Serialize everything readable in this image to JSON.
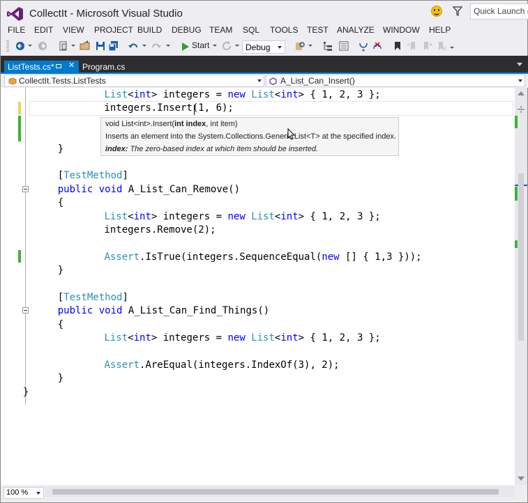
{
  "window": {
    "title": "CollectIt - Microsoft Visual Studio",
    "quick_launch_placeholder": "Quick Launch (Ctrl+Q)"
  },
  "menu": [
    "FILE",
    "EDIT",
    "VIEW",
    "PROJECT",
    "BUILD",
    "DEBUG",
    "TEAM",
    "SQL",
    "TOOLS",
    "TEST",
    "ANALYZE",
    "WINDOW",
    "HELP"
  ],
  "toolbar": {
    "start_label": "Start",
    "configuration": "Debug"
  },
  "tabs": [
    {
      "label": "ListTests.cs*",
      "active": true
    },
    {
      "label": "Program.cs",
      "active": false
    }
  ],
  "navbar": {
    "type": "CollectIt.Tests.ListTests",
    "member": "A_List_Can_Insert()"
  },
  "code": [
    [
      "        ",
      "List",
      "<",
      "int",
      "> integers = ",
      "new",
      " ",
      "List",
      "<",
      "int",
      "> { 1, 2, 3 };"
    ],
    [
      "        integers.Insert(1, 6);"
    ],
    [
      ""
    ],
    [
      ""
    ],
    [
      "    }"
    ],
    [
      ""
    ],
    [
      "    [",
      "TestMethod",
      "]"
    ],
    [
      "    ",
      "public",
      " ",
      "void",
      " A_List_Can_Remove()"
    ],
    [
      "    {"
    ],
    [
      "        ",
      "List",
      "<",
      "int",
      "> integers = ",
      "new",
      " ",
      "List",
      "<",
      "int",
      "> { 1, 2, 3 };"
    ],
    [
      "        integers.Remove(2);"
    ],
    [
      ""
    ],
    [
      "        ",
      "Assert",
      ".IsTrue(integers.SequenceEqual(",
      "new",
      " [] { 1,3 }));"
    ],
    [
      "    }"
    ],
    [
      ""
    ],
    [
      "    [",
      "TestMethod",
      "]"
    ],
    [
      "    ",
      "public",
      " ",
      "void",
      " A_List_Can_Find_Things()"
    ],
    [
      "    {"
    ],
    [
      "        ",
      "List",
      "<",
      "int",
      "> integers = ",
      "new",
      " ",
      "List",
      "<",
      "int",
      "> { 1, 2, 3 };"
    ],
    [
      ""
    ],
    [
      "        ",
      "Assert",
      ".AreEqual(integers.IndexOf(3), 2);"
    ],
    [
      "    }"
    ],
    [
      "  }"
    ],
    [
      "}"
    ]
  ],
  "tooltip": {
    "signature_prefix": "void List<int>.Insert(",
    "signature_bold": "int index",
    "signature_suffix": ", int item)",
    "description": "Inserts an element into the System.Collections.Generic.List<T> at the specified index.",
    "param_name": "index:",
    "param_desc": " The zero-based index at which item should be inserted."
  },
  "zoom": "100 %",
  "colors": {
    "keyword": "#0000ff",
    "type": "#2b91af",
    "accent": "#007acc",
    "change_mark": "#3cb43c"
  }
}
